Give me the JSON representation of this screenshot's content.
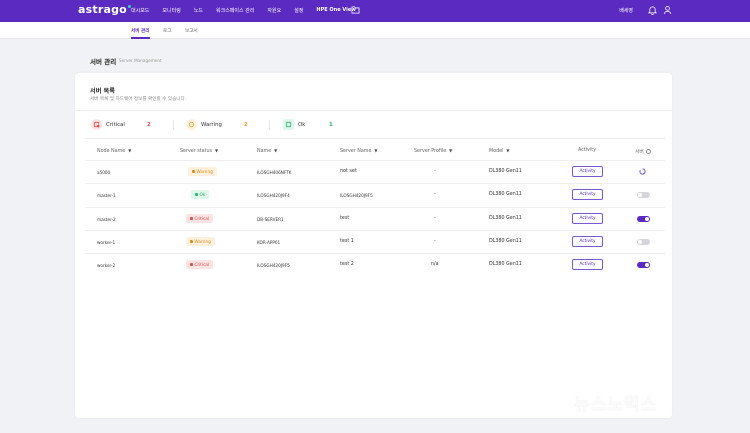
{
  "app": {
    "logo": "astrago"
  },
  "topnav": {
    "items": [
      "대시보드",
      "모니터링",
      "노드",
      "워크스페이스 관리",
      "자원요",
      "설정"
    ],
    "hpe_label": "HPE One View",
    "user": "배세영"
  },
  "subnav": {
    "tabs": [
      "서버 관리",
      "로그",
      "보고서"
    ]
  },
  "page": {
    "title": "서버 관리",
    "subtitle": "Server Management"
  },
  "card": {
    "title": "서버 목록",
    "desc": "서버 목록 및 하드웨어 정보를 확인할 수 있습니다."
  },
  "summary": [
    {
      "label": "Critical",
      "count": "2",
      "color": "#e14b4b"
    },
    {
      "label": "Warring",
      "count": "2",
      "color": "#f0a13a"
    },
    {
      "label": "Ok",
      "count": "1",
      "color": "#2bb673"
    }
  ],
  "table": {
    "headers": [
      "Node Name",
      "Server status",
      "Name",
      "Server Name",
      "Server Profile",
      "Model",
      "Activity",
      "서버"
    ],
    "rows": [
      {
        "node": "a5000",
        "status": "Warring",
        "name": "ILOSGH406NFTK",
        "server": "not set",
        "profile": "-",
        "model": "DL380 Gen11",
        "activity": "Activity",
        "power": "loading"
      },
      {
        "node": "master-1",
        "status": "Ok",
        "name": "ILOSGH420J9F4",
        "server": "ILOSGH420J9F5",
        "profile": "-",
        "model": "DL380 Gen11",
        "activity": "Activity",
        "power": "off"
      },
      {
        "node": "master-2",
        "status": "Critical",
        "name": "DB-SERVER1",
        "server": "test",
        "profile": "-",
        "model": "DL380 Gen11",
        "activity": "Activity",
        "power": "on"
      },
      {
        "node": "worker-1",
        "status": "Warring",
        "name": "KOR-APP01",
        "server": "test 1",
        "profile": "-",
        "model": "DL380 Gen11",
        "activity": "Activity",
        "power": "off"
      },
      {
        "node": "worker-2",
        "status": "Critical",
        "name": "ILOSGH420J9F5",
        "server": "test 2",
        "profile": "n/a",
        "model": "DL380 Gen11",
        "activity": "Activity",
        "power": "on"
      }
    ]
  },
  "colors": {
    "brand": "#5b2ac0",
    "warning_bg": "#fff1dd",
    "warning_fg": "#e08a1e",
    "ok_bg": "#dff6ea",
    "ok_fg": "#2bb673",
    "critical_bg": "#fde4e4",
    "critical_fg": "#e14b4b"
  },
  "watermark": "뉴스노믹스"
}
